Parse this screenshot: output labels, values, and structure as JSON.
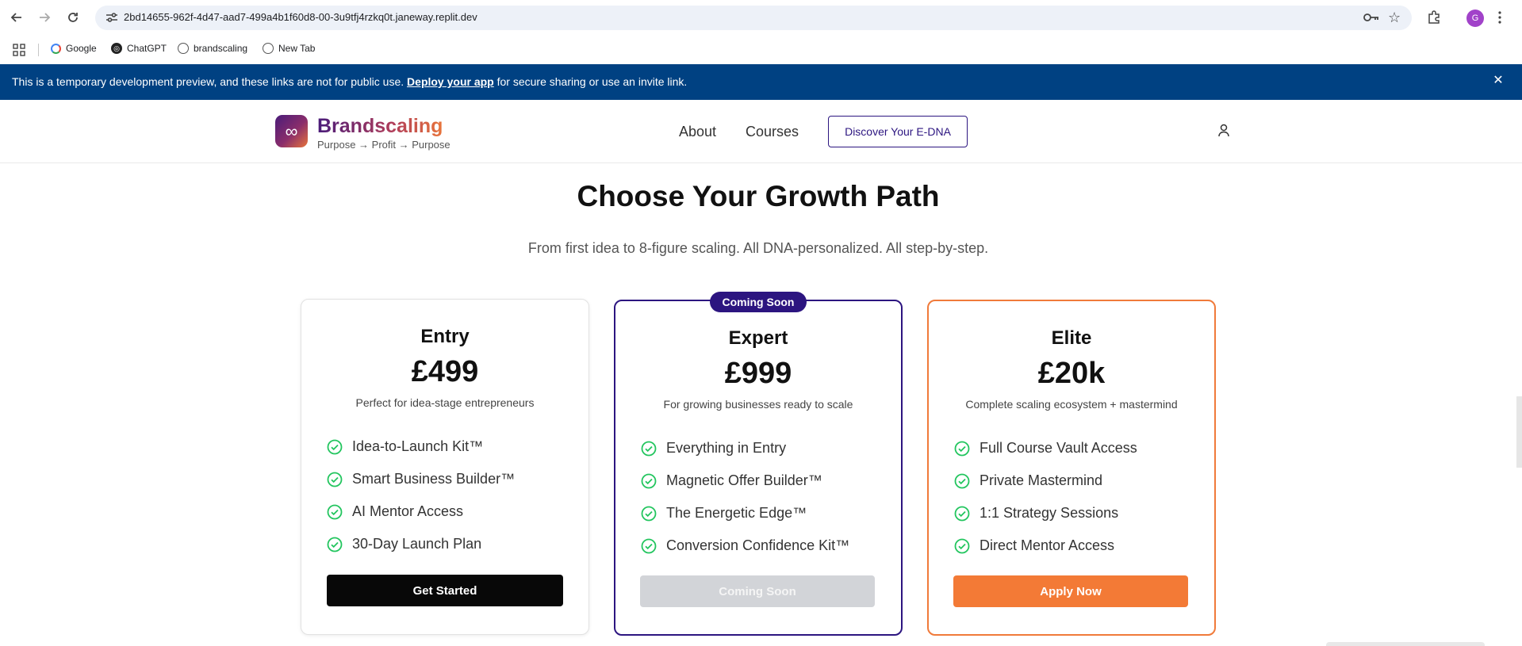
{
  "browser": {
    "url": "2bd14655-962f-4d47-aad7-499a4b1f60d8-00-3u9tfj4rzkq0t.janeway.replit.dev",
    "avatar_letter": "G",
    "bookmarks": [
      {
        "label": "Google",
        "icon": "google-icon"
      },
      {
        "label": "ChatGPT",
        "icon": "chatgpt-icon"
      },
      {
        "label": "brandscaling",
        "icon": "globe-icon"
      },
      {
        "label": "New Tab",
        "icon": "globe-icon"
      }
    ]
  },
  "banner": {
    "prefix": "This is a temporary development preview, and these links are not for public use. ",
    "link": "Deploy your app",
    "suffix": " for secure sharing or use an invite link."
  },
  "header": {
    "logo_symbol": "∞",
    "brand": "Brandscaling",
    "tagline": "Purpose → Profit → Purpose",
    "nav": [
      "About",
      "Courses"
    ],
    "cta": "Discover Your E-DNA"
  },
  "main": {
    "title": "Choose Your Growth Path",
    "subtitle": "From first idea to 8-figure scaling. All DNA-personalized. All step-by-step."
  },
  "plans": [
    {
      "name": "Entry",
      "price": "£499",
      "description": "Perfect for idea-stage entrepreneurs",
      "features": [
        "Idea-to-Launch Kit™",
        "Smart Business Builder™",
        "AI Mentor Access",
        "30-Day Launch Plan"
      ],
      "button": "Get Started"
    },
    {
      "badge": "Coming Soon",
      "name": "Expert",
      "price": "£999",
      "description": "For growing businesses ready to scale",
      "features": [
        "Everything in Entry",
        "Magnetic Offer Builder™",
        "The Energetic Edge™",
        "Conversion Confidence Kit™"
      ],
      "button": "Coming Soon"
    },
    {
      "name": "Elite",
      "price": "£20k",
      "description": "Complete scaling ecosystem + mastermind",
      "features": [
        "Full Course Vault Access",
        "Private Mastermind",
        "1:1 Strategy Sessions",
        "Direct Mentor Access"
      ],
      "button": "Apply Now"
    }
  ],
  "colors": {
    "banner": "#004182",
    "brand_purple": "#2c1580",
    "brand_orange": "#f37a36",
    "check_green": "#22c55e"
  }
}
